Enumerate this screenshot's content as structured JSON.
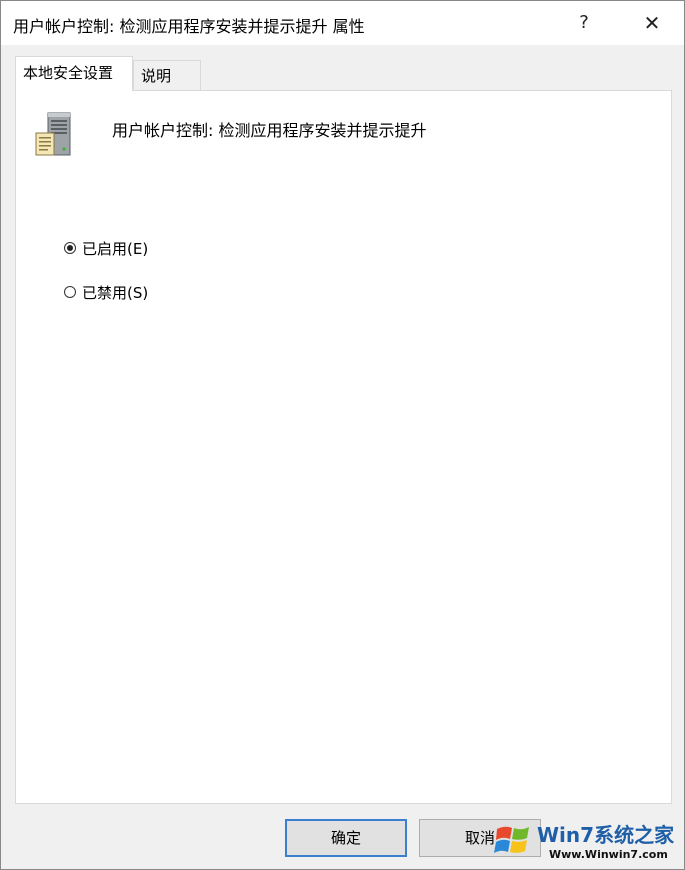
{
  "window": {
    "title": "用户帐户控制: 检测应用程序安装并提示提升 属性",
    "help_label": "?",
    "close_label": "✕"
  },
  "tabs": [
    {
      "label": "本地安全设置",
      "active": true
    },
    {
      "label": "说明",
      "active": false
    }
  ],
  "policy": {
    "icon": "server-icon",
    "title": "用户帐户控制: 检测应用程序安装并提示提升"
  },
  "options": [
    {
      "label": "已启用(E)",
      "checked": true
    },
    {
      "label": "已禁用(S)",
      "checked": false
    }
  ],
  "buttons": {
    "ok_label": "确定",
    "cancel_label": "取消"
  },
  "watermark": {
    "brand": "Win7系统之家",
    "url": "Www.Winwin7.com"
  },
  "colors": {
    "focus_border": "#3c7fd0",
    "watermark_blue": "#1f5fa8"
  }
}
